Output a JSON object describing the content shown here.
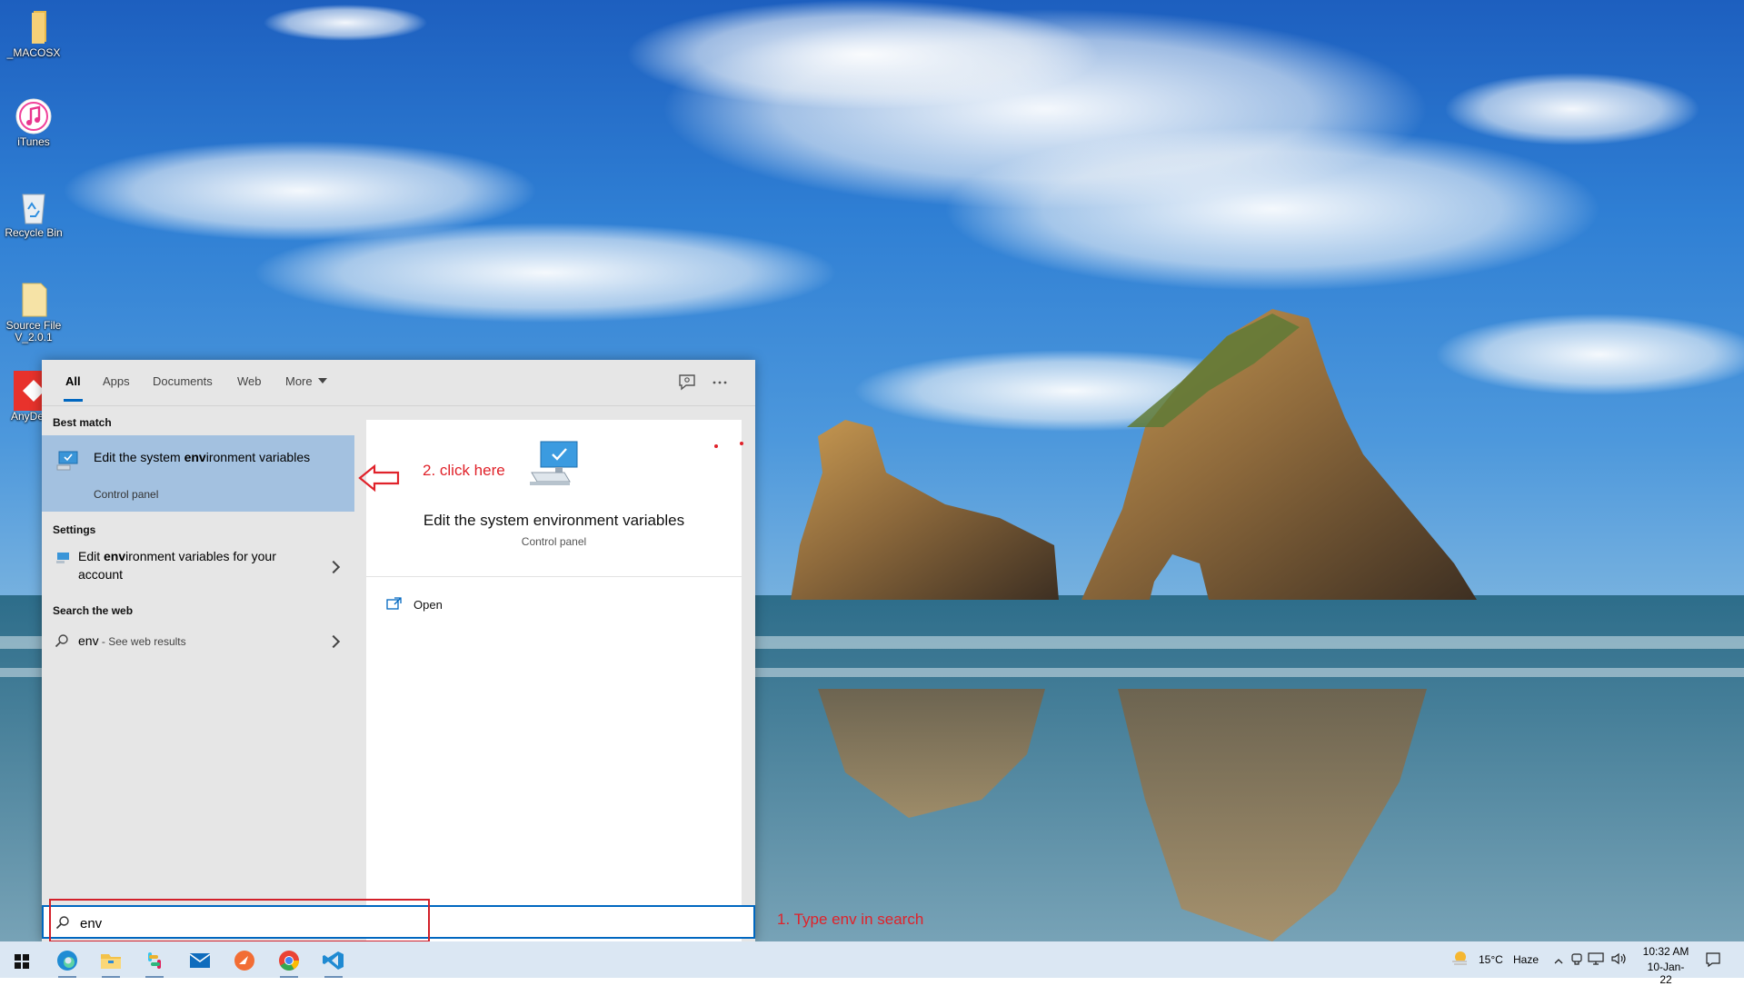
{
  "desktop": {
    "icons": [
      {
        "label": "_MACOSX"
      },
      {
        "label": "iTunes"
      },
      {
        "label": "Recycle Bin"
      },
      {
        "label": "Source File V_2.0.1"
      },
      {
        "label": "AnyDe"
      }
    ]
  },
  "search_panel": {
    "tabs": [
      {
        "label": "All",
        "active": true
      },
      {
        "label": "Apps"
      },
      {
        "label": "Documents"
      },
      {
        "label": "Web"
      },
      {
        "label": "More"
      }
    ],
    "sections": {
      "best_match": "Best match",
      "settings": "Settings",
      "search_web": "Search the web"
    },
    "best_match": {
      "title_prefix": "Edit the system ",
      "title_bold": "env",
      "title_suffix": "ironment variables",
      "subtitle": "Control panel"
    },
    "settings_result": {
      "prefix": "Edit ",
      "bold": "env",
      "suffix": "ironment variables for your account"
    },
    "web_result": {
      "query": "env",
      "hint": " - See web results"
    },
    "preview": {
      "title": "Edit the system environment variables",
      "subtitle": "Control panel",
      "action_open": "Open"
    }
  },
  "search_box": {
    "value": "env"
  },
  "annotations": {
    "step1": "1. Type env in search",
    "step2": "2. click here",
    "color": "#e0222a"
  },
  "taskbar": {
    "apps": [
      "start",
      "edge",
      "file-explorer",
      "slack",
      "mail",
      "swift-playgrounds",
      "chrome",
      "vscode"
    ],
    "weather": {
      "temp": "15°C",
      "condition": "Haze"
    },
    "clock": {
      "time": "10:32 AM",
      "date": "10-Jan-22"
    }
  }
}
